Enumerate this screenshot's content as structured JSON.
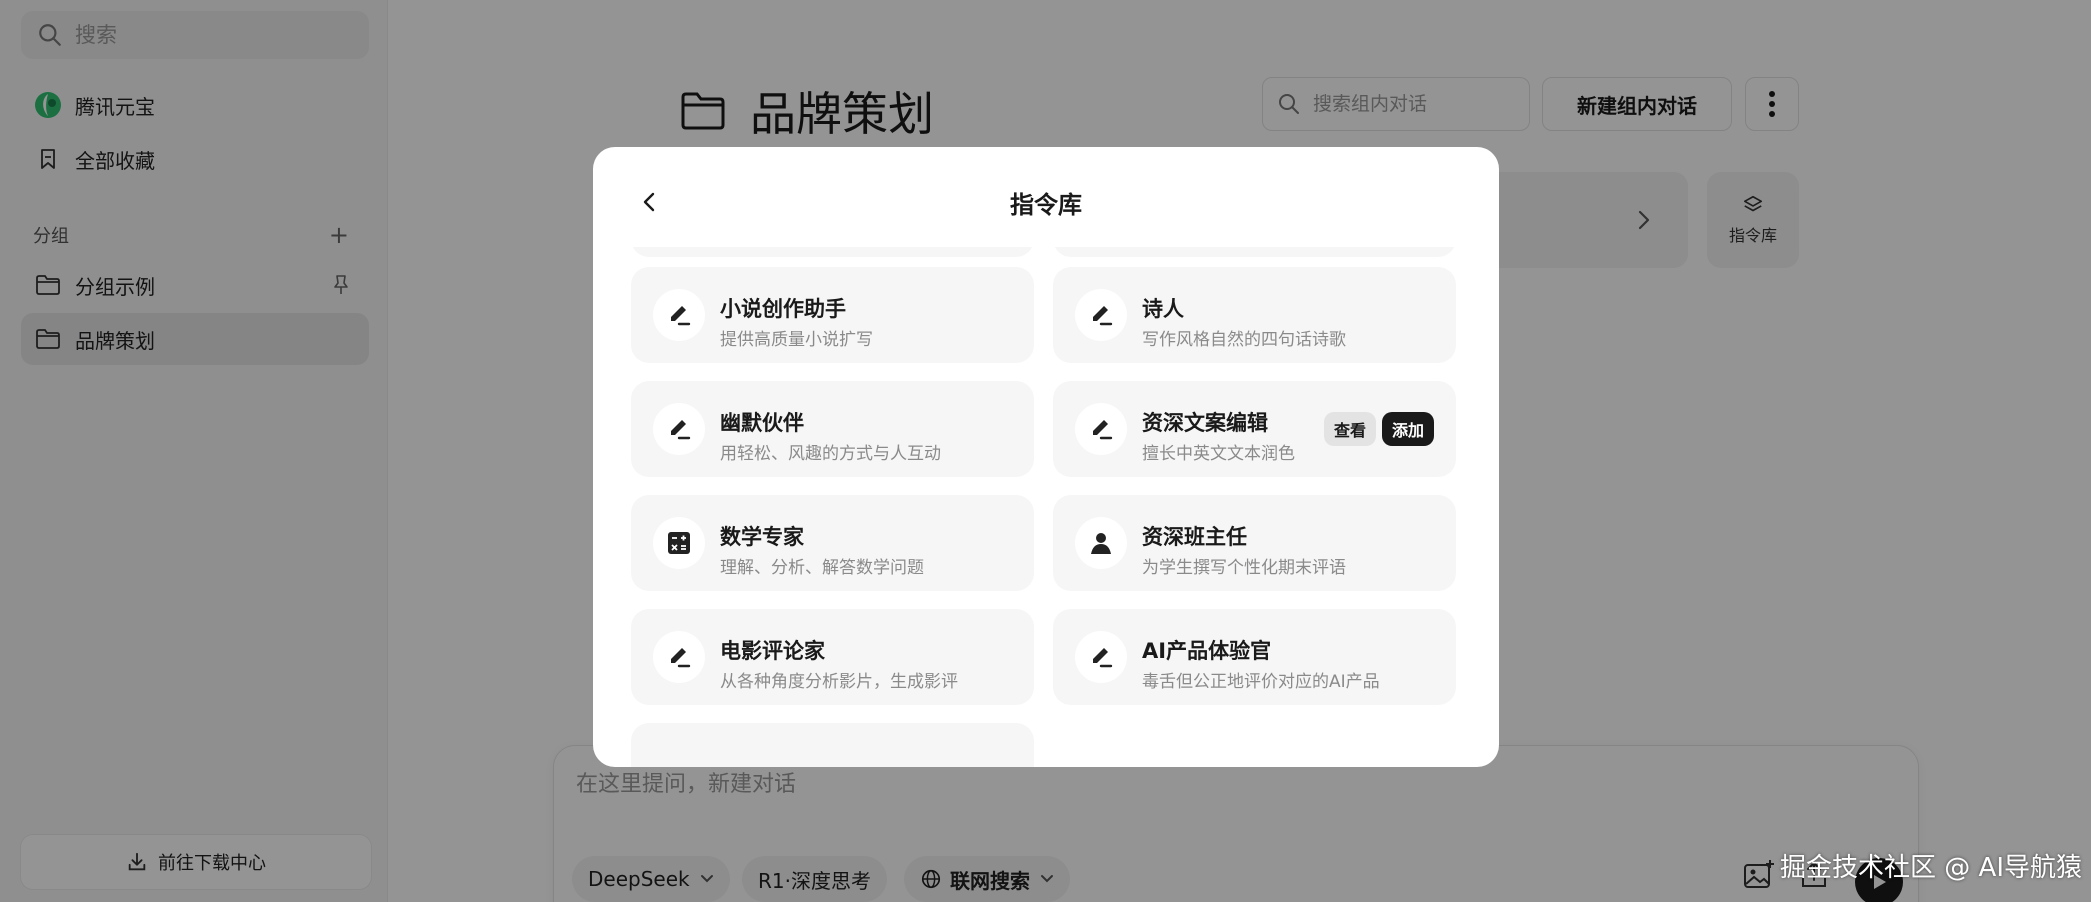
{
  "sidebar": {
    "search_placeholder": "搜索",
    "items": [
      {
        "label": "腾讯元宝"
      },
      {
        "label": "全部收藏"
      }
    ],
    "group_title": "分组",
    "groups": [
      {
        "label": "分组示例"
      },
      {
        "label": "品牌策划"
      }
    ],
    "download_label": "前往下载中心"
  },
  "main": {
    "title": "品牌策划",
    "group_search_placeholder": "搜索组内对话",
    "new_chat_label": "新建组内对话",
    "cmd_lib_label": "指令库",
    "composer": {
      "placeholder": "在这里提问，新建对话",
      "model_label": "DeepSeek",
      "think_label": "R1·深度思考",
      "web_label": "联网搜索"
    }
  },
  "modal": {
    "title": "指令库",
    "cards": [
      {
        "name": "小说创作助手",
        "desc": "提供高质量小说扩写",
        "icon": "pencil-icon"
      },
      {
        "name": "诗人",
        "desc": "写作风格自然的四句话诗歌",
        "icon": "pencil-icon"
      },
      {
        "name": "幽默伙伴",
        "desc": "用轻松、风趣的方式与人互动",
        "icon": "pencil-icon"
      },
      {
        "name": "资深文案编辑",
        "desc": "擅长中英文文本润色",
        "icon": "pencil-icon",
        "view_label": "查看",
        "add_label": "添加"
      },
      {
        "name": "数学专家",
        "desc": "理解、分析、解答数学问题",
        "icon": "calculator-icon"
      },
      {
        "name": "资深班主任",
        "desc": "为学生撰写个性化期末评语",
        "icon": "person-icon"
      },
      {
        "name": "电影评论家",
        "desc": "从各种角度分析影片，生成影评",
        "icon": "pencil-icon"
      },
      {
        "name": "AI产品体验官",
        "desc": "毒舌但公正地评价对应的AI产品",
        "icon": "pencil-icon"
      }
    ]
  },
  "watermark": "掘金技术社区 @ AI导航猿"
}
